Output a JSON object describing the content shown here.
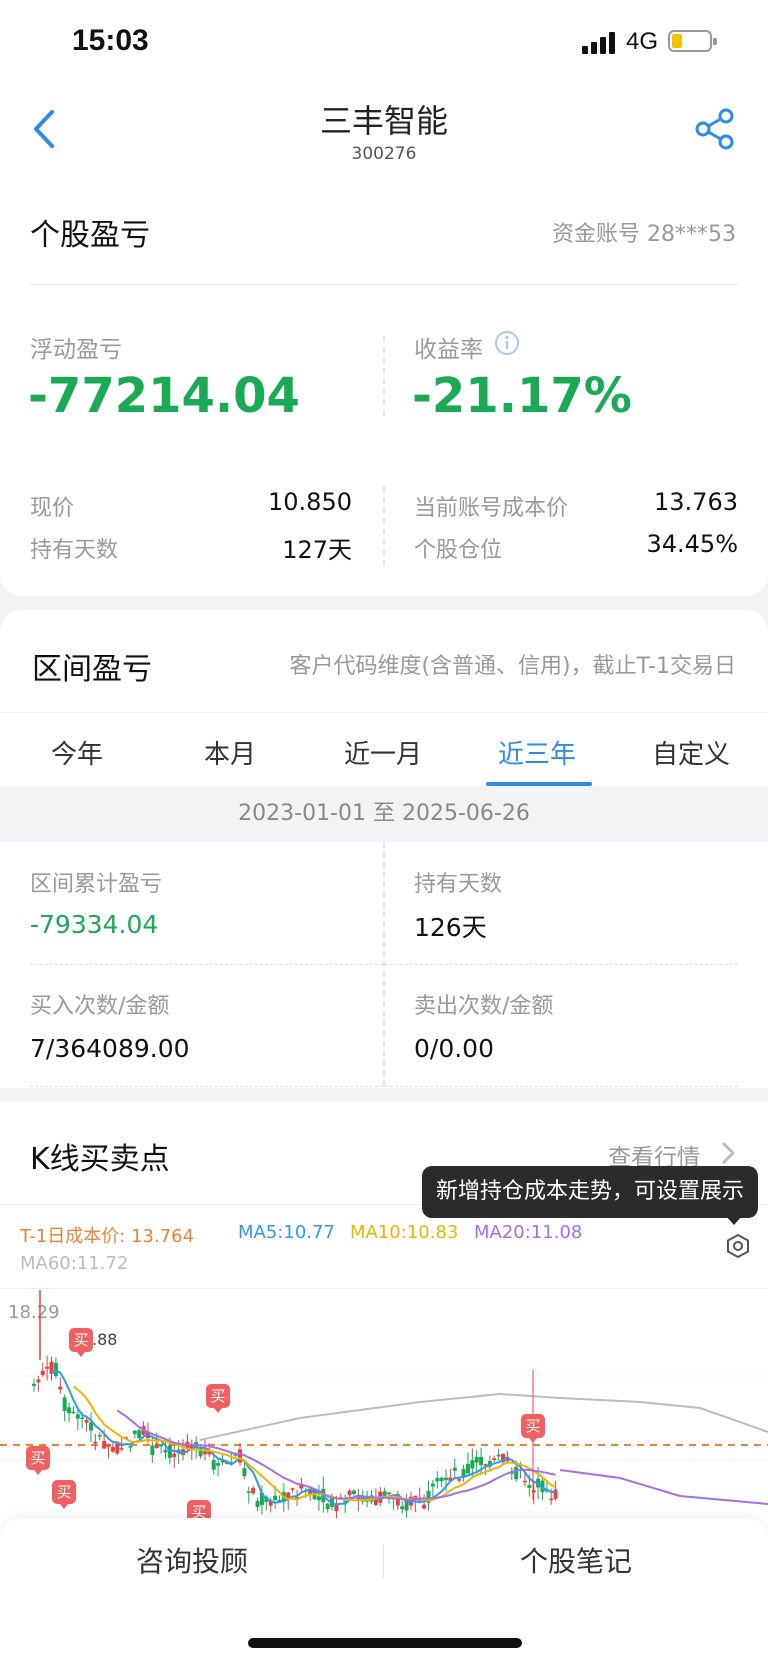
{
  "status_bar": {
    "time": "15:03",
    "network": "4G"
  },
  "header": {
    "title": "三丰智能",
    "code": "300276"
  },
  "holding": {
    "title": "个股盈亏",
    "account_label": "资金账号 28***53",
    "floating_pl_label": "浮动盈亏",
    "floating_pl_value": "-77214.04",
    "return_label": "收益率",
    "return_value": "-21.17%",
    "price_label": "现价",
    "price_value": "10.850",
    "days_label": "持有天数",
    "days_value": "127天",
    "cost_label": "当前账号成本价",
    "cost_value": "13.763",
    "position_label": "个股仓位",
    "position_value": "34.45%"
  },
  "range": {
    "title": "区间盈亏",
    "note": "客户代码维度(含普通、信用)，截止T-1交易日",
    "tabs": [
      "今年",
      "本月",
      "近一月",
      "近三年",
      "自定义"
    ],
    "active_tab": 3,
    "date_range": "2023-01-01 至 2025-06-26",
    "cum_pl_label": "区间累计盈亏",
    "cum_pl_value": "-79334.04",
    "hold_days_label": "持有天数",
    "hold_days_value": "126天",
    "buy_label": "买入次数/金额",
    "buy_value": "7/364089.00",
    "sell_label": "卖出次数/金额",
    "sell_value": "0/0.00"
  },
  "kline": {
    "title": "K线买卖点",
    "view_market": "查看行情",
    "tooltip": "新增持仓成本走势，可设置展示",
    "cost_legend": "T-1日成本价: 13.764",
    "ma5": "MA5:10.77",
    "ma10": "MA10:10.83",
    "ma20": "MA20:11.08",
    "ma60": "MA60:11.72",
    "max_price": "18.29",
    "max_tag": ".88",
    "buy_mark": "买",
    "colors": {
      "cost": "#e8843a",
      "ma5": "#2e9be8",
      "ma10": "#f0b400",
      "ma20": "#a86ee8",
      "ma60": "#bbbbbb",
      "up": "#e84040",
      "down": "#1aaa55"
    }
  },
  "bottom": {
    "left": "咨询投顾",
    "right": "个股笔记"
  }
}
